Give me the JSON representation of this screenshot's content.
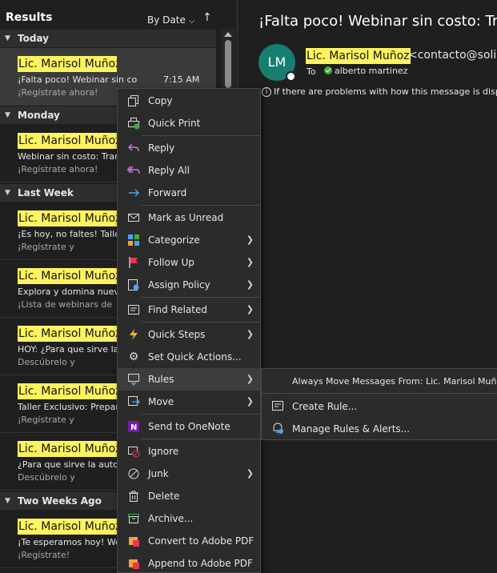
{
  "list": {
    "title": "Results",
    "sort_label": "By Date",
    "sort_chevron": "⌵",
    "sort_direction_icon": "↑"
  },
  "groups": [
    {
      "label": "Today"
    },
    {
      "label": "Monday"
    },
    {
      "label": "Last Week"
    },
    {
      "label": "Two Weeks Ago"
    }
  ],
  "messages": [
    {
      "sender": "Lic. Marisol Muñoz",
      "subject": "¡Falta poco! Webinar sin co...",
      "preview": "¡Regístrate ahora!",
      "time": "7:15 AM",
      "selected": true
    },
    {
      "sender": "Lic. Marisol Muñoz",
      "subject": "Webinar sin costo: Tran",
      "preview": "¡Regístrate ahora!",
      "time": "",
      "selected": false
    },
    {
      "sender": "Lic. Marisol Muñoz",
      "subject": "¡Es hoy, no faltes! Taller",
      "preview": "¡Regístrate y",
      "time": "",
      "selected": false
    },
    {
      "sender": "Lic. Marisol Muñoz",
      "subject": "Explora y domina nueva",
      "preview": "¡Lista de webinars de",
      "time": "",
      "selected": false
    },
    {
      "sender": "Lic. Marisol Muñoz",
      "subject": "HOY: ¿Para que sirve la a",
      "preview": "Descúbrelo y",
      "time": "",
      "selected": false
    },
    {
      "sender": "Lic. Marisol Muñoz",
      "subject": "Taller Exclusivo: Prepara",
      "preview": "¡Regístrate y",
      "time": "",
      "selected": false
    },
    {
      "sender": "Lic. Marisol Muñoz",
      "subject": "¿Para que sirve la autom",
      "preview": "Descúbrelo y",
      "time": "",
      "selected": false
    },
    {
      "sender": "Lic. Marisol Muñoz",
      "subject": "¡Te esperamos hoy! Webir",
      "preview": "¡Regístrate!",
      "time": "",
      "selected": false
    }
  ],
  "reading": {
    "subject": "¡Falta poco! Webinar sin costo: Tran",
    "avatar_initials": "LM",
    "from_name": "Lic. Marisol Muñoz",
    "from_address": "<contacto@solid",
    "to_label": "To",
    "to_name": "alberto martinez",
    "info_text": "If there are problems with how this message is display"
  },
  "context_menu": [
    {
      "label": "Copy",
      "icon": "copy-icon",
      "submenu": false
    },
    {
      "label": "Quick Print",
      "icon": "quick-print-icon",
      "submenu": false
    },
    {
      "label": "Reply",
      "icon": "reply-icon",
      "submenu": false
    },
    {
      "label": "Reply All",
      "icon": "reply-all-icon",
      "submenu": false
    },
    {
      "label": "Forward",
      "icon": "forward-icon",
      "submenu": false
    },
    {
      "label": "Mark as Unread",
      "icon": "envelope-icon",
      "submenu": false
    },
    {
      "label": "Categorize",
      "icon": "categorize-icon",
      "submenu": true
    },
    {
      "label": "Follow Up",
      "icon": "flag-icon",
      "submenu": true
    },
    {
      "label": "Assign Policy",
      "icon": "policy-icon",
      "submenu": true
    },
    {
      "label": "Find Related",
      "icon": "find-related-icon",
      "submenu": true
    },
    {
      "label": "Quick Steps",
      "icon": "lightning-icon",
      "submenu": true
    },
    {
      "label": "Set Quick Actions...",
      "icon": "gear-icon",
      "submenu": false
    },
    {
      "label": "Rules",
      "icon": "rules-icon",
      "submenu": true
    },
    {
      "label": "Move",
      "icon": "move-icon",
      "submenu": true
    },
    {
      "label": "Send to OneNote",
      "icon": "onenote-icon",
      "submenu": false
    },
    {
      "label": "Ignore",
      "icon": "ignore-icon",
      "submenu": false
    },
    {
      "label": "Junk",
      "icon": "junk-icon",
      "submenu": true
    },
    {
      "label": "Delete",
      "icon": "trash-icon",
      "submenu": false
    },
    {
      "label": "Archive...",
      "icon": "archive-icon",
      "submenu": false
    },
    {
      "label": "Convert to Adobe PDF",
      "icon": "adobe-pdf-icon",
      "submenu": false
    },
    {
      "label": "Append to Adobe PDF",
      "icon": "adobe-pdf-append-icon",
      "submenu": false
    }
  ],
  "rules_submenu": [
    {
      "label": "Always Move Messages From: Lic. Marisol Muñoz"
    },
    {
      "label": "Create Rule..."
    },
    {
      "label": "Manage Rules & Alerts..."
    }
  ],
  "colors": {
    "highlight": "#fff35f",
    "avatar": "#177e70",
    "flag": "#e8384f",
    "accent_blue": "#4aa3ff",
    "onenote": "#7719aa"
  }
}
